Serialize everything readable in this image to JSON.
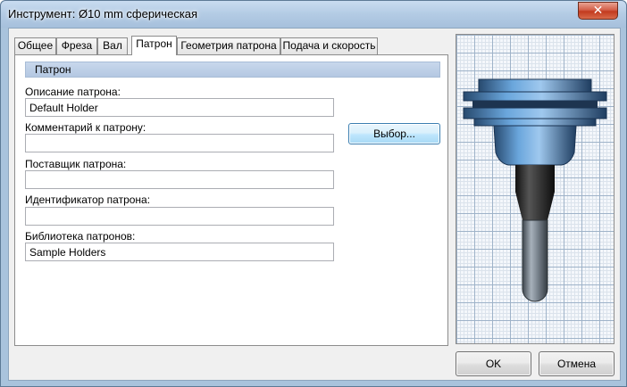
{
  "window": {
    "title": "Инструмент: Ø10 mm сферическая",
    "close_glyph": "✕"
  },
  "tabs": [
    {
      "label": "Общее",
      "active": false
    },
    {
      "label": "Фреза",
      "active": false
    },
    {
      "label": "Вал",
      "active": false
    },
    {
      "label": "Патрон",
      "active": true
    },
    {
      "label": "Геометрия патрона",
      "active": false
    },
    {
      "label": "Подача и скорость",
      "active": false
    }
  ],
  "panel": {
    "section_title": "Патрон",
    "fields": [
      {
        "label": "Описание патрона:",
        "value": ""
      },
      {
        "label": "Комментарий к патрону:",
        "value": ""
      },
      {
        "label": "Поставщик патрона:",
        "value": ""
      },
      {
        "label": "Идентификатор патрона:",
        "value": ""
      },
      {
        "label": "Библиотека патронов:",
        "value": ""
      }
    ],
    "description_value": "Default Holder",
    "library_value": "Sample Holders",
    "select_button": "Выбор..."
  },
  "buttons": {
    "ok": "OK",
    "cancel": "Отмена"
  },
  "colors": {
    "holder_blue": "#5b93c8",
    "shank_dark": "#2a2a2a",
    "tool_gray": "#707a84"
  }
}
